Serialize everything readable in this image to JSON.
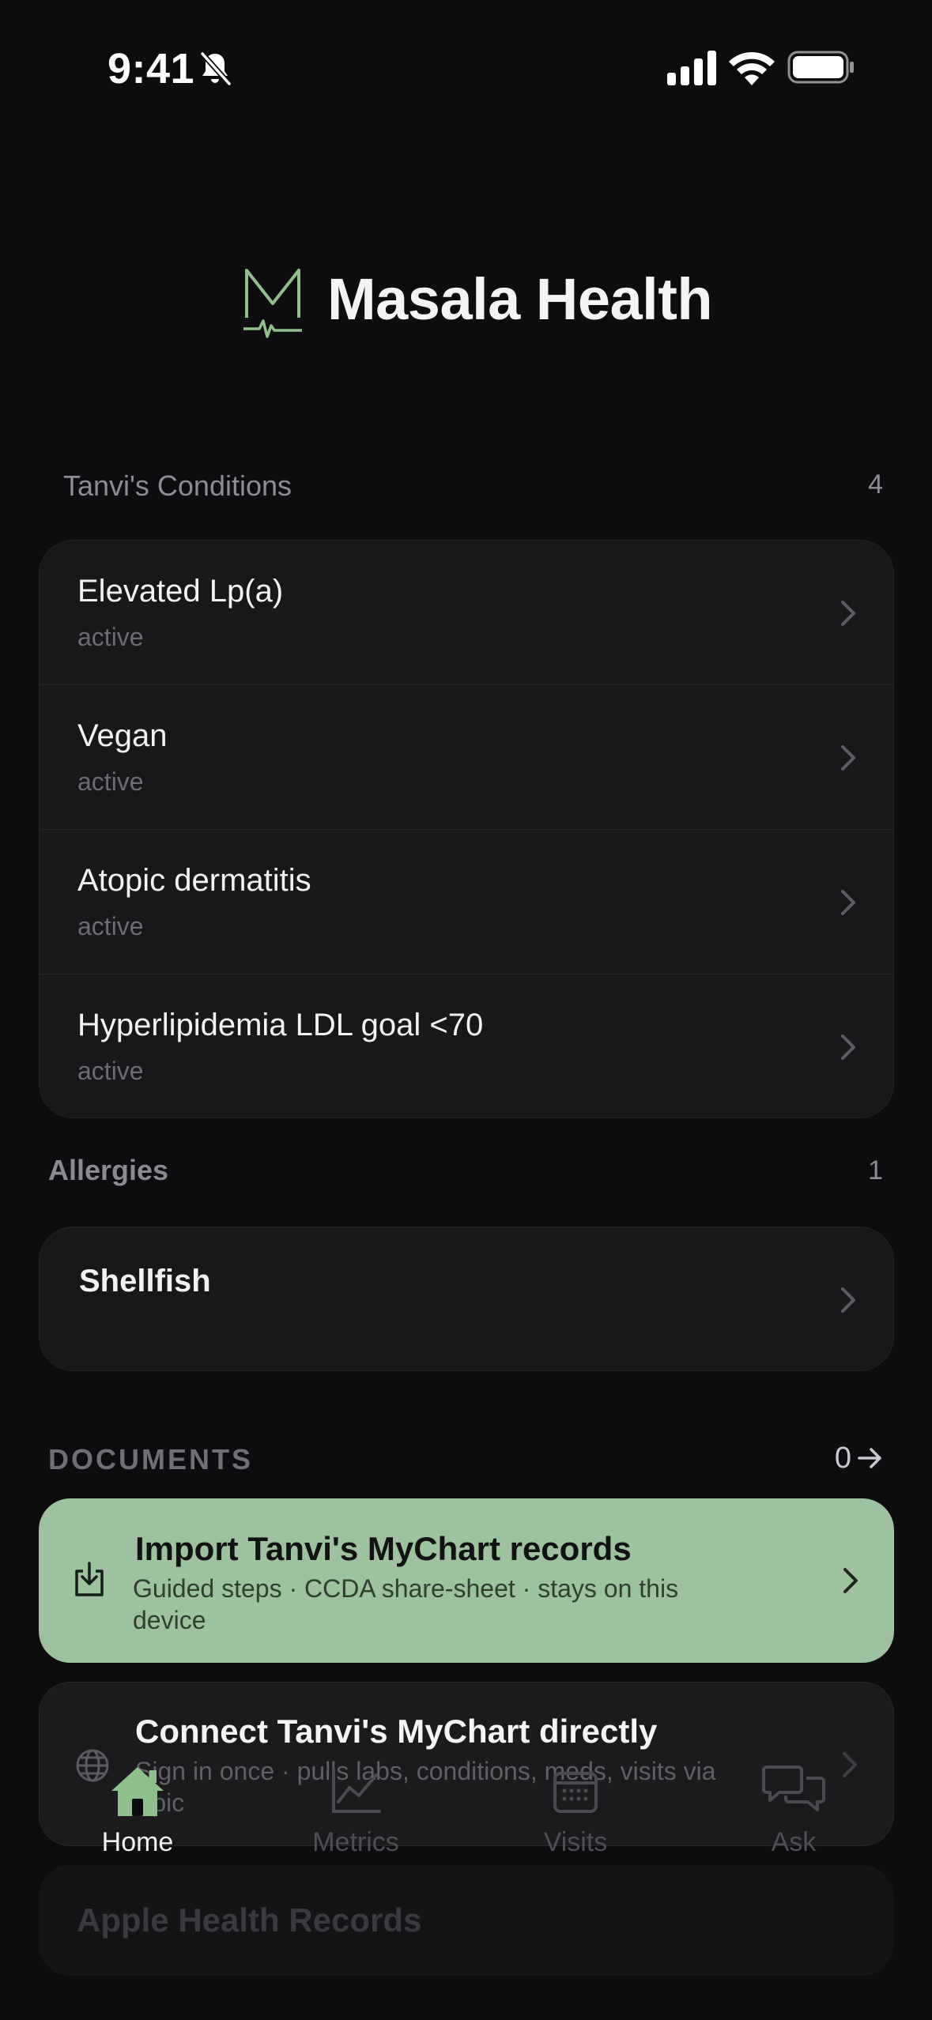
{
  "status": {
    "time": "9:41"
  },
  "header": {
    "app_title": "Masala Health"
  },
  "conditions": {
    "label": "Tanvi's Conditions",
    "count": "4",
    "items": [
      {
        "title": "Elevated Lp(a)",
        "status": "active"
      },
      {
        "title": "Vegan",
        "status": "active"
      },
      {
        "title": "Atopic dermatitis",
        "status": "active"
      },
      {
        "title": "Hyperlipidemia LDL goal <70",
        "status": "active"
      }
    ]
  },
  "allergies": {
    "label": "Allergies",
    "count": "1",
    "items": [
      {
        "title": "Shellfish"
      }
    ]
  },
  "documents": {
    "label": "DOCUMENTS",
    "count": "0",
    "import": {
      "title": "Import Tanvi's MyChart records",
      "subtitle": "Guided steps · CCDA share-sheet · stays on this device"
    },
    "connect": {
      "title": "Connect Tanvi's MyChart directly",
      "subtitle": "Sign in once · pulls labs, conditions, meds, visits via Epic"
    },
    "apple_health": {
      "title": "Apple Health Records"
    }
  },
  "tabs": [
    {
      "label": "Home",
      "icon": "home-icon",
      "active": true
    },
    {
      "label": "Metrics",
      "icon": "chart-icon",
      "active": false
    },
    {
      "label": "Visits",
      "icon": "calendar-icon",
      "active": false
    },
    {
      "label": "Ask",
      "icon": "chat-bubbles-icon",
      "active": false
    }
  ],
  "colors": {
    "accent": "#9ec29d",
    "background": "#0d0d0f",
    "card": "#18181b"
  }
}
